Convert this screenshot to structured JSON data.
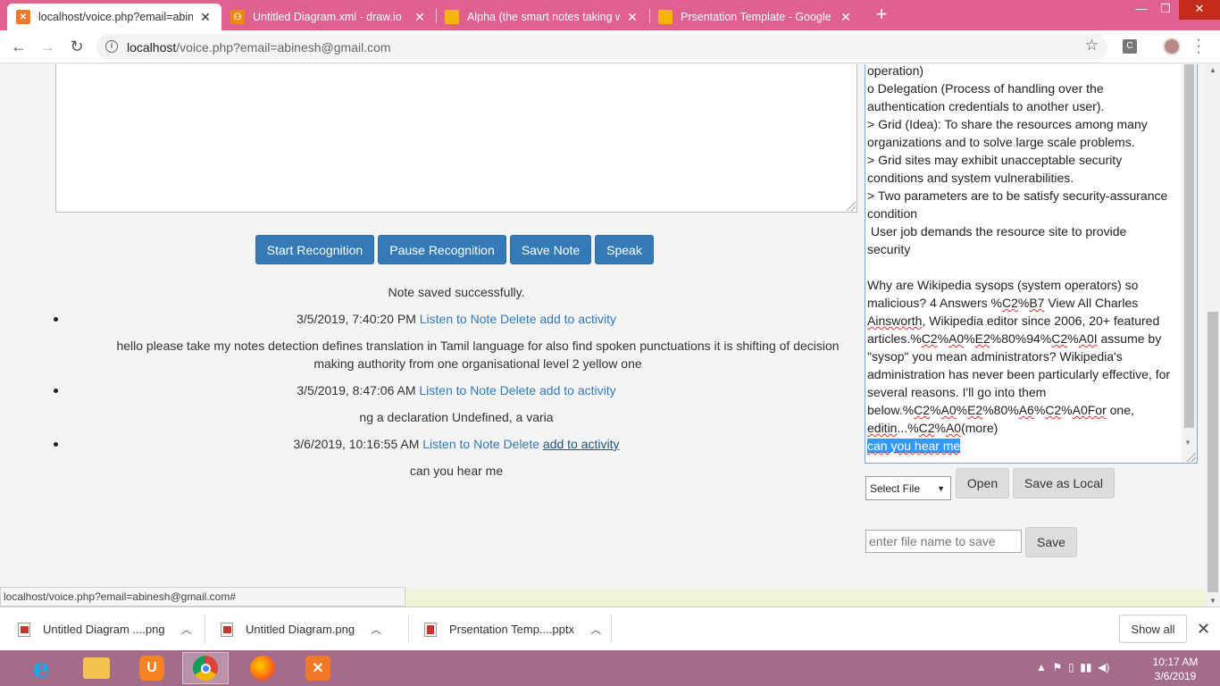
{
  "browser": {
    "tabs": [
      {
        "title": "localhost/voice.php?email=abine",
        "active": true,
        "favicon": "xampp-icon"
      },
      {
        "title": "Untitled Diagram.xml - draw.io",
        "active": false,
        "favicon": "drawio-icon"
      },
      {
        "title": "Alpha (the smart notes taking we",
        "active": false,
        "favicon": "slides-icon"
      },
      {
        "title": "Prsentation Template - Google Sl",
        "active": false,
        "favicon": "slides-icon"
      }
    ],
    "url_host": "localhost",
    "url_path": "/voice.php?email=abinesh@gmail.com",
    "extension_label": "C"
  },
  "page": {
    "buttons": {
      "start": "Start Recognition",
      "pause": "Pause Recognition",
      "save_note": "Save Note",
      "speak": "Speak"
    },
    "status_message": "Note saved successfully.",
    "notes": [
      {
        "timestamp": "3/5/2019, 7:40:20 PM",
        "listen": "Listen to Note",
        "delete": "Delete",
        "activity": "add to activity",
        "text": "hello please take my notes detection defines translation in Tamil language for also find spoken punctuations it is shifting of decision making authority from one organisational level 2 yellow one"
      },
      {
        "timestamp": "3/5/2019, 8:47:06 AM",
        "listen": "Listen to Note",
        "delete": "Delete",
        "activity": "add to activity",
        "text": "ng a declaration Undefined, a varia"
      },
      {
        "timestamp": "3/6/2019, 10:16:55 AM",
        "listen": "Listen to Note",
        "delete": "Delete",
        "activity": "add to activity",
        "text": "can you hear me"
      }
    ],
    "side_text": {
      "line1": "operation)",
      "line2": "o Delegation (Process of handling over the",
      "line3": "authentication credentials to another user).",
      "line4": "> Grid (Idea): To share the resources among many",
      "line5": "organizations and to solve large scale problems.",
      "line6": "> Grid sites may exhibit unacceptable security",
      "line7": "conditions and system vulnerabilities.",
      "line8": "> Two parameters are to be satisfy security-assurance",
      "line9": "condition",
      "line10": " User job demands the resource site to provide",
      "line11": "security",
      "line12": "Why are Wikipedia sysops (system operators) so",
      "line13a": "malicious? 4 Answers %",
      "line13b": "C2",
      "line13c": "%",
      "line13d": "B7",
      "line13e": " View All Charles",
      "line14a": "Ainsworth",
      "line14b": ", Wikipedia editor since 2006, 20+ featured",
      "line15a": "articles.%",
      "line15b": "C2",
      "line15c": "%",
      "line15d": "A0",
      "line15e": "%",
      "line15f": "E2",
      "line15g": "%80%94%",
      "line15h": "C2",
      "line15i": "%",
      "line15j": "A0I",
      "line15k": " assume by",
      "line16": "\"sysop\" you mean administrators? Wikipedia's",
      "line17": "administration has never been particularly effective, for",
      "line18": "several reasons. I'll go into them",
      "line19a": "below.%",
      "line19b": "C2",
      "line19c": "%",
      "line19d": "A0",
      "line19e": "%",
      "line19f": "E2",
      "line19g": "%80%",
      "line19h": "A6",
      "line19i": "%",
      "line19j": "C2",
      "line19k": "%",
      "line19l": "A0For",
      "line19m": " one,",
      "line20a": "editin",
      "line20b": "...%",
      "line20c": "C2",
      "line20d": "%",
      "line20e": "A0",
      "line20f": "(more)",
      "selected": "can you hear me"
    },
    "select_file": "Select File",
    "open_button": "Open",
    "save_local_button": "Save as Local",
    "filename_placeholder": "enter file name to save",
    "save_button": "Save"
  },
  "status_bar": "localhost/voice.php?email=abinesh@gmail.com#",
  "downloads": [
    {
      "name": "Untitled Diagram ....png",
      "type": "png"
    },
    {
      "name": "Untitled Diagram.png",
      "type": "png"
    },
    {
      "name": "Prsentation Temp....pptx",
      "type": "pptx"
    }
  ],
  "show_all": "Show all",
  "taskbar": {
    "time": "10:17 AM",
    "date": "3/6/2019"
  },
  "colors": {
    "tabstrip": "#e0608f",
    "primary_button": "#337ab7",
    "taskbar": "#a46c8a"
  }
}
